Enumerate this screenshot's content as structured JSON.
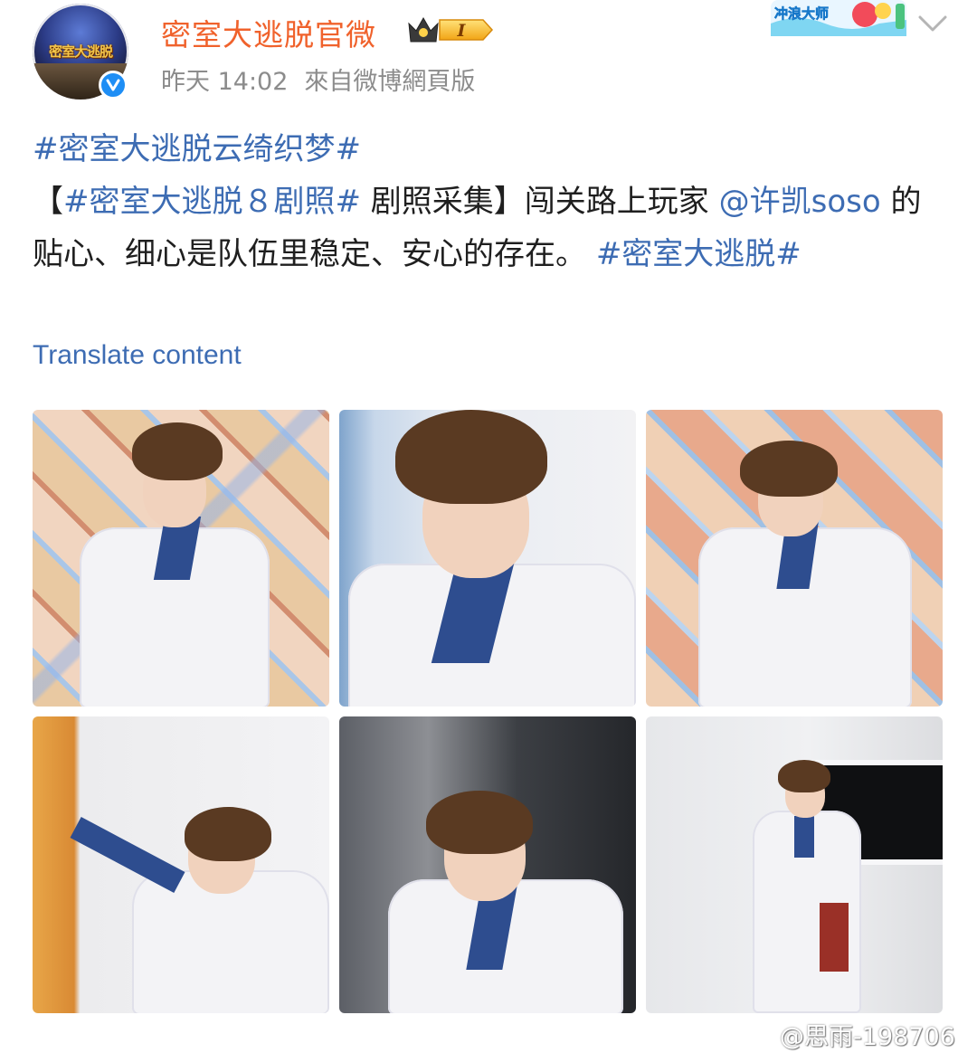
{
  "header": {
    "account_name": "密室大逃脱官微",
    "member_level": "I",
    "time": "昨天 14:02",
    "source": "來自微博網頁版",
    "avatar_logo_text": "密室大逃脱",
    "banner_text": "冲浪大师"
  },
  "post": {
    "segments": [
      {
        "type": "tag",
        "text": "#密室大逃脱云绮织梦#"
      },
      {
        "type": "br"
      },
      {
        "type": "bracket",
        "text": "【"
      },
      {
        "type": "tag",
        "text": "#密室大逃脱８剧照#"
      },
      {
        "type": "text",
        "text": " 剧照采集"
      },
      {
        "type": "bracket",
        "text": "】"
      },
      {
        "type": "text",
        "text": "闯关路上玩家 "
      },
      {
        "type": "mention",
        "text": "@许凯soso"
      },
      {
        "type": "text",
        "text": " 的贴心、细心是队伍里稳定、安心的存在。 "
      },
      {
        "type": "tag",
        "text": "#密室大逃脱#"
      }
    ],
    "translate_label": "Translate content"
  },
  "photos": [
    {
      "id": "photo-1",
      "scene": "leaning over table, patterned wall"
    },
    {
      "id": "photo-2",
      "scene": "close-up looking down"
    },
    {
      "id": "photo-3",
      "scene": "hands on table, patterned wall"
    },
    {
      "id": "photo-4",
      "scene": "reaching toward orange wall"
    },
    {
      "id": "photo-5",
      "scene": "seated, dark background"
    },
    {
      "id": "photo-6",
      "scene": "standing full body, white room"
    }
  ],
  "watermark": "@思雨-198706",
  "colors": {
    "account_name": "#f0622c",
    "link": "#3d6cb3",
    "meta": "#8c8c8c",
    "verified": "#1e8ef5"
  }
}
